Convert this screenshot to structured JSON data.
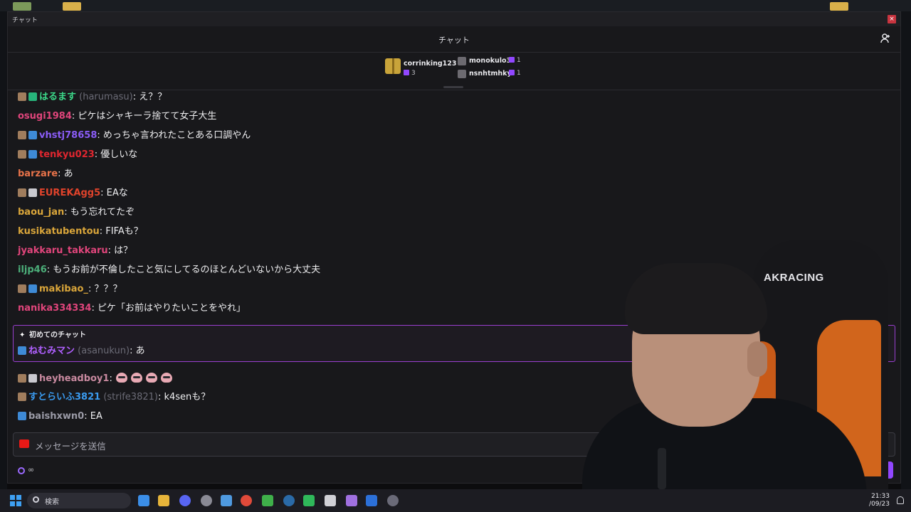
{
  "window": {
    "title": "チャット",
    "close_label": "×"
  },
  "chat": {
    "header_title": "チャット",
    "gifters": [
      {
        "name": "corrinking123",
        "count": "3"
      },
      {
        "name": "monokulo3",
        "count": "1"
      },
      {
        "name": "nsnhtmhky",
        "count": "1"
      }
    ],
    "messages": [
      {
        "user": "はるます",
        "login": "(harumasu)",
        "text": ": え？？",
        "color": "#3cd98a"
      },
      {
        "user": "osugi1984",
        "login": "",
        "text": ": ピケはシャキーラ捨てて女子大生",
        "color": "#e0457b"
      },
      {
        "user": "vhstj78658",
        "login": "",
        "text": ": めっちゃ言われたことある口調やん",
        "color": "#8a5cf6"
      },
      {
        "user": "tenkyu023",
        "login": "",
        "text": ": 優しいな",
        "color": "#e0262f"
      },
      {
        "user": "barzare",
        "login": "",
        "text": ": あ",
        "color": "#e8734a"
      },
      {
        "user": "EUREKAgg5",
        "login": "",
        "text": ": EAな",
        "color": "#e0432b"
      },
      {
        "user": "baou_jan",
        "login": "",
        "text": ": もう忘れてたぞ",
        "color": "#d9a53a"
      },
      {
        "user": "kusikatubentou",
        "login": "",
        "text": ": FIFAも？",
        "color": "#d9a53a"
      },
      {
        "user": "jyakkaru_takkaru",
        "login": "",
        "text": ": は？",
        "color": "#e0457b"
      },
      {
        "user": "iljp46",
        "login": "",
        "text": ": もうお前が不倫したこと気にしてるのほとんどいないから大丈夫",
        "color": "#4caf7a"
      },
      {
        "user": "makibao_",
        "login": "",
        "text": ": ？？？",
        "color": "#d9a53a"
      },
      {
        "user": "nanika334334",
        "login": "",
        "text": ": ピケ「お前はやりたいことをやれ」",
        "color": "#e0457b"
      }
    ],
    "first_chat": {
      "header": "初めてのチャット",
      "user": "ねむみマン",
      "login": "(asanukun)",
      "text": ": あ",
      "color": "#b060ff"
    },
    "later_messages": [
      {
        "user": "heyheadboy1",
        "login": "",
        "text": ":",
        "color": "#c98aa0"
      },
      {
        "user": "すとらいふ3821",
        "login": "(strife3821)",
        "text": ": k4senも？",
        "color": "#3a9bf0"
      },
      {
        "user": "baishxwn0",
        "login": "",
        "text": ": EA",
        "color": "#9a9aa6"
      }
    ],
    "input_placeholder": "メッセージを送信",
    "points_label": "∞"
  },
  "webcam": {
    "chair_brand": "AKRACING"
  },
  "taskbar": {
    "search_label": "検索",
    "time": "21:33",
    "date": "/09/23"
  }
}
